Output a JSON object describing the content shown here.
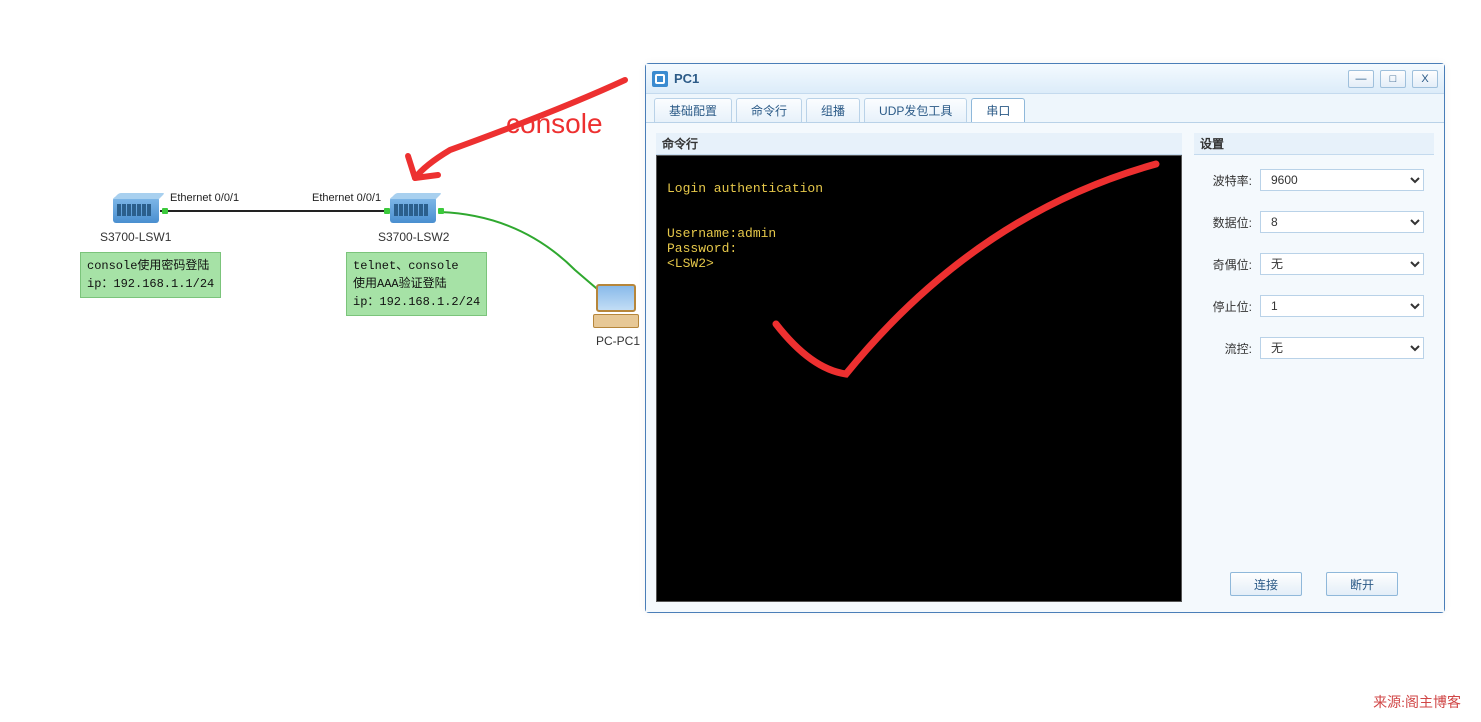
{
  "topology": {
    "sw1_label": "S3700-LSW1",
    "sw2_label": "S3700-LSW2",
    "pc_label": "PC-PC1",
    "port1_label": "Ethernet 0/0/1",
    "port2_label": "Ethernet 0/0/1",
    "note1": "console使用密码登陆\nip：192.168.1.1/24\n",
    "note2": "telnet、console\n使用AAA验证登陆\nip：192.168.1.2/24",
    "annotation": "console"
  },
  "window": {
    "title": "PC1",
    "tabs": {
      "t0": "基础配置",
      "t1": "命令行",
      "t2": "组播",
      "t3": "UDP发包工具",
      "t4": "串口"
    },
    "terminal": {
      "header": "命令行",
      "content": "\nLogin authentication\n\n\nUsername:admin\nPassword:\n<LSW2>"
    },
    "settings": {
      "header": "设置",
      "baud_label": "波特率:",
      "baud_value": "9600",
      "databits_label": "数据位:",
      "databits_value": "8",
      "parity_label": "奇偶位:",
      "parity_value": "无",
      "stopbits_label": "停止位:",
      "stopbits_value": "1",
      "flow_label": "流控:",
      "flow_value": "无"
    },
    "buttons": {
      "connect": "连接",
      "disconnect": "断开"
    }
  },
  "footer": {
    "source": "来源:阁主博客"
  }
}
